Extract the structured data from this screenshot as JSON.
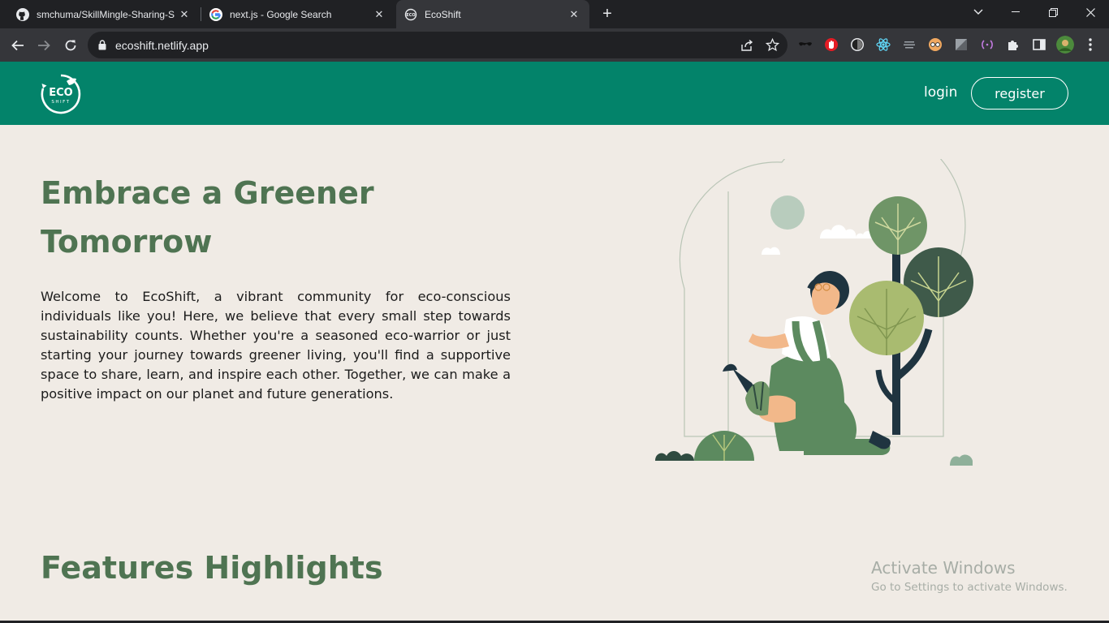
{
  "browser": {
    "tabs": [
      {
        "title": "smchuma/SkillMingle-Sharing-S",
        "icon": "github-icon",
        "active": false
      },
      {
        "title": "next.js - Google Search",
        "icon": "google-icon",
        "active": false
      },
      {
        "title": "EcoShift",
        "icon": "ecoshift-favicon",
        "active": true
      }
    ],
    "url": "ecoshift.netlify.app"
  },
  "site": {
    "logo_text_top": "ECO",
    "logo_text_bottom": "SHIFT",
    "nav": {
      "login": "login",
      "register": "register"
    },
    "hero": {
      "title": "Embrace a Greener Tomorrow",
      "text": "Welcome to EcoShift, a vibrant community for eco-conscious individuals like you! Here, we believe that every small step towards sustainability counts. Whether you're a seasoned eco-warrior or just starting your journey towards greener living, you'll find a supportive space to share, learn, and inspire each other. Together, we can make a positive impact on our planet and future generations."
    },
    "features_title": "Features Highlights"
  },
  "watermark": {
    "line1": "Activate Windows",
    "line2": "Go to Settings to activate Windows."
  },
  "colors": {
    "brand_green": "#03836a",
    "heading_green": "#4f7452",
    "page_bg": "#f0ebe5"
  }
}
